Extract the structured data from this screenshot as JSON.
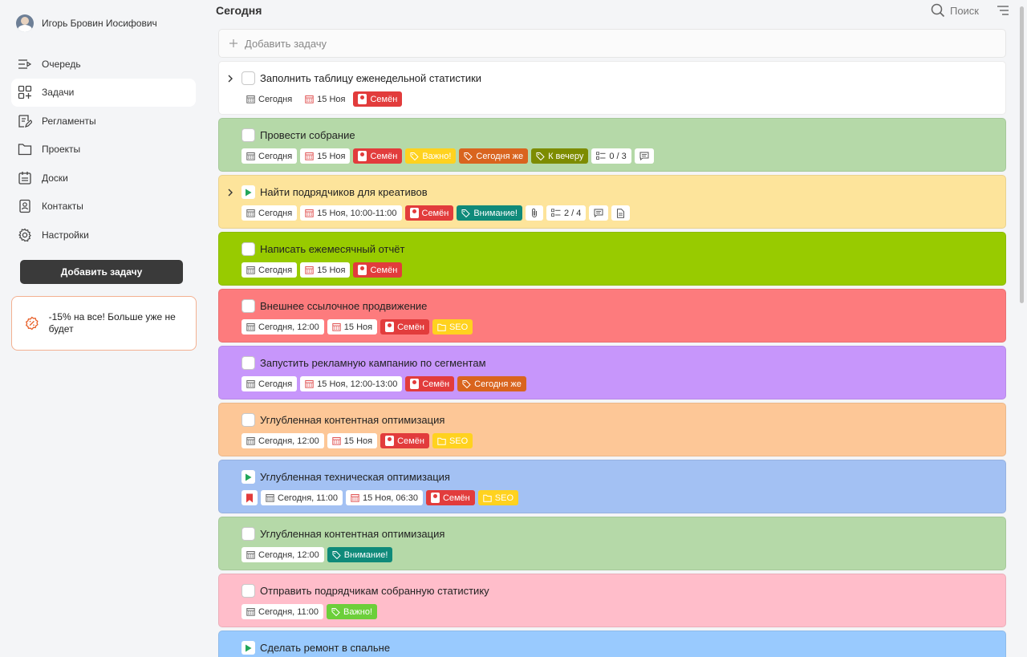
{
  "user": {
    "name": "Игорь Бровин Иосифович"
  },
  "nav": [
    {
      "label": "Очередь",
      "icon": "queue-icon",
      "active": false
    },
    {
      "label": "Задачи",
      "icon": "tasks-icon",
      "active": true
    },
    {
      "label": "Регламенты",
      "icon": "regulations-icon",
      "active": false
    },
    {
      "label": "Проекты",
      "icon": "folder-icon",
      "active": false
    },
    {
      "label": "Доски",
      "icon": "board-icon",
      "active": false
    },
    {
      "label": "Контакты",
      "icon": "contacts-icon",
      "active": false
    },
    {
      "label": "Настройки",
      "icon": "gear-icon",
      "active": false
    }
  ],
  "sidebar": {
    "add_button": "Добавить задачу",
    "promo_text": "-15% на все! Больше уже не будет"
  },
  "header": {
    "title": "Сегодня",
    "search_label": "Поиск"
  },
  "add_task_placeholder": "Добавить задачу",
  "colors": {
    "red": "#e23c3c",
    "yellow": "#ffd21f",
    "orange": "#d9641e",
    "olive": "#7d8c00",
    "teal": "#0f8a7a",
    "green": "#6ccf3a"
  },
  "tasks": [
    {
      "title": "Заполнить таблицу еженедельной статистики",
      "bg": "#ffffff",
      "chevron": true,
      "marker": "checkbox",
      "tags": [
        {
          "kind": "date",
          "text": "Сегодня"
        },
        {
          "kind": "deadline",
          "text": "15 Ноя"
        },
        {
          "kind": "person",
          "text": "Семён"
        }
      ]
    },
    {
      "title": "Провести собрание",
      "bg": "#b5d9a8",
      "chevron": false,
      "marker": "checkbox",
      "tags": [
        {
          "kind": "date",
          "text": "Сегодня"
        },
        {
          "kind": "deadline",
          "text": "15 Ноя"
        },
        {
          "kind": "person",
          "text": "Семён"
        },
        {
          "kind": "label",
          "text": "Важно!",
          "color": "yellow"
        },
        {
          "kind": "label",
          "text": "Сегодня же",
          "color": "orange"
        },
        {
          "kind": "label",
          "text": "К вечеру",
          "color": "olive"
        },
        {
          "kind": "checklist",
          "text": "0 / 3"
        },
        {
          "kind": "comment",
          "text": ""
        }
      ]
    },
    {
      "title": "Найти подрядчиков для креативов",
      "bg": "#fde49b",
      "chevron": true,
      "marker": "play",
      "tags": [
        {
          "kind": "date",
          "text": "Сегодня"
        },
        {
          "kind": "deadline",
          "text": "15 Ноя, 10:00-11:00"
        },
        {
          "kind": "person",
          "text": "Семён"
        },
        {
          "kind": "label",
          "text": "Внимание!",
          "color": "teal"
        },
        {
          "kind": "attach",
          "text": ""
        },
        {
          "kind": "checklist",
          "text": "2 / 4"
        },
        {
          "kind": "comment",
          "text": ""
        },
        {
          "kind": "doc",
          "text": ""
        }
      ]
    },
    {
      "title": "Написать ежемесячный отчёт",
      "bg": "#98cb00",
      "chevron": false,
      "marker": "checkbox",
      "tags": [
        {
          "kind": "date",
          "text": "Сегодня"
        },
        {
          "kind": "deadline",
          "text": "15 Ноя"
        },
        {
          "kind": "person",
          "text": "Семён"
        }
      ]
    },
    {
      "title": "Внешнее ссылочное продвижение",
      "bg": "#fd7b7d",
      "chevron": false,
      "marker": "checkbox",
      "tags": [
        {
          "kind": "date",
          "text": "Сегодня, 12:00"
        },
        {
          "kind": "deadline",
          "text": "15 Ноя"
        },
        {
          "kind": "person",
          "text": "Семён"
        },
        {
          "kind": "project",
          "text": "SEO"
        }
      ]
    },
    {
      "title": "Запустить рекламную кампанию по сегментам",
      "bg": "#c796fb",
      "chevron": false,
      "marker": "checkbox",
      "tags": [
        {
          "kind": "date",
          "text": "Сегодня"
        },
        {
          "kind": "deadline",
          "text": "15 Ноя, 12:00-13:00"
        },
        {
          "kind": "person",
          "text": "Семён"
        },
        {
          "kind": "label",
          "text": "Сегодня же",
          "color": "orange"
        }
      ]
    },
    {
      "title": "Углубленная контентная оптимизация",
      "bg": "#fdc797",
      "chevron": false,
      "marker": "checkbox",
      "tags": [
        {
          "kind": "date",
          "text": "Сегодня, 12:00"
        },
        {
          "kind": "deadline",
          "text": "15 Ноя"
        },
        {
          "kind": "person",
          "text": "Семён"
        },
        {
          "kind": "project",
          "text": "SEO"
        }
      ]
    },
    {
      "title": "Углубленная техническая оптимизация",
      "bg": "#a3c1f3",
      "chevron": false,
      "marker": "play",
      "tags": [
        {
          "kind": "flag",
          "text": ""
        },
        {
          "kind": "date",
          "text": "Сегодня, 11:00"
        },
        {
          "kind": "deadline",
          "text": "15 Ноя, 06:30"
        },
        {
          "kind": "person",
          "text": "Семён"
        },
        {
          "kind": "project",
          "text": "SEO"
        }
      ]
    },
    {
      "title": "Углубленная контентная оптимизация",
      "bg": "#b5d9a8",
      "chevron": false,
      "marker": "checkbox",
      "tags": [
        {
          "kind": "date",
          "text": "Сегодня, 12:00"
        },
        {
          "kind": "label",
          "text": "Внимание!",
          "color": "teal"
        }
      ]
    },
    {
      "title": "Отправить подрядчикам собранную статистику",
      "bg": "#ffbdca",
      "chevron": false,
      "marker": "checkbox",
      "tags": [
        {
          "kind": "date",
          "text": "Сегодня, 11:00"
        },
        {
          "kind": "label",
          "text": "Важно!",
          "color": "green"
        }
      ]
    },
    {
      "title": "Сделать ремонт в спальне",
      "bg": "#99cafe",
      "chevron": false,
      "marker": "play",
      "tags": []
    }
  ]
}
